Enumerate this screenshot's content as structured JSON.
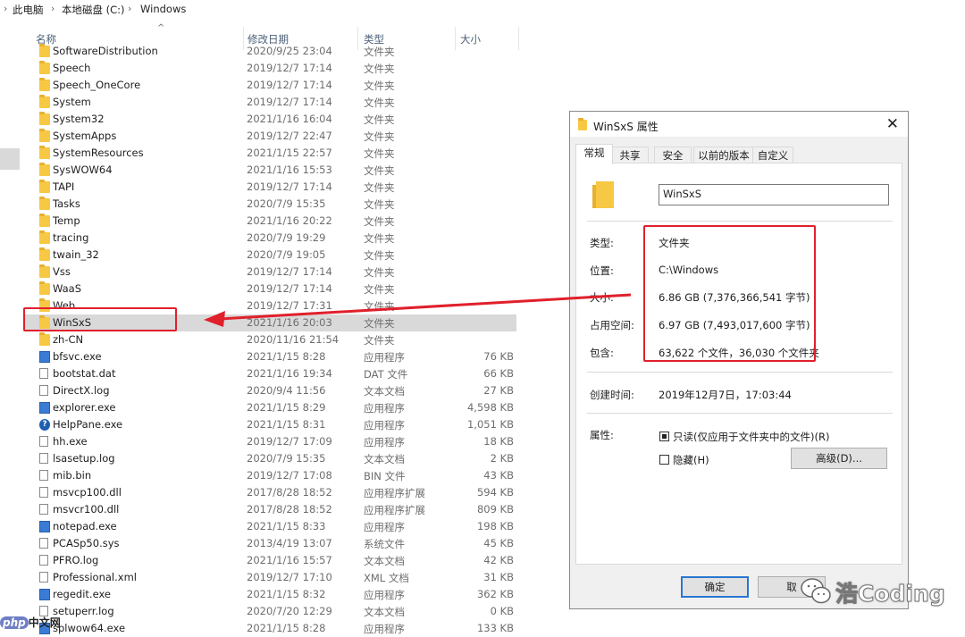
{
  "breadcrumb": [
    "此电脑",
    "本地磁盘 (C:)",
    "Windows"
  ],
  "columns": {
    "name": "名称",
    "date": "修改日期",
    "type": "类型",
    "size": "大小"
  },
  "files": [
    {
      "name": "SoftwareDistribution",
      "date": "2020/9/25 23:04",
      "type": "文件夹",
      "size": "",
      "icon": "folder-icon"
    },
    {
      "name": "Speech",
      "date": "2019/12/7 17:14",
      "type": "文件夹",
      "size": "",
      "icon": "folder-icon"
    },
    {
      "name": "Speech_OneCore",
      "date": "2019/12/7 17:14",
      "type": "文件夹",
      "size": "",
      "icon": "folder-icon"
    },
    {
      "name": "System",
      "date": "2019/12/7 17:14",
      "type": "文件夹",
      "size": "",
      "icon": "folder-icon"
    },
    {
      "name": "System32",
      "date": "2021/1/16 16:04",
      "type": "文件夹",
      "size": "",
      "icon": "folder-icon"
    },
    {
      "name": "SystemApps",
      "date": "2019/12/7 22:47",
      "type": "文件夹",
      "size": "",
      "icon": "folder-icon"
    },
    {
      "name": "SystemResources",
      "date": "2021/1/15 22:57",
      "type": "文件夹",
      "size": "",
      "icon": "folder-icon"
    },
    {
      "name": "SysWOW64",
      "date": "2021/1/16 15:53",
      "type": "文件夹",
      "size": "",
      "icon": "folder-icon"
    },
    {
      "name": "TAPI",
      "date": "2019/12/7 17:14",
      "type": "文件夹",
      "size": "",
      "icon": "folder-icon"
    },
    {
      "name": "Tasks",
      "date": "2020/7/9 15:35",
      "type": "文件夹",
      "size": "",
      "icon": "folder-icon"
    },
    {
      "name": "Temp",
      "date": "2021/1/16 20:22",
      "type": "文件夹",
      "size": "",
      "icon": "folder-icon"
    },
    {
      "name": "tracing",
      "date": "2020/7/9 19:29",
      "type": "文件夹",
      "size": "",
      "icon": "folder-icon"
    },
    {
      "name": "twain_32",
      "date": "2020/7/9 19:05",
      "type": "文件夹",
      "size": "",
      "icon": "folder-icon"
    },
    {
      "name": "Vss",
      "date": "2019/12/7 17:14",
      "type": "文件夹",
      "size": "",
      "icon": "folder-icon"
    },
    {
      "name": "WaaS",
      "date": "2019/12/7 17:14",
      "type": "文件夹",
      "size": "",
      "icon": "folder-icon"
    },
    {
      "name": "Web",
      "date": "2019/12/7 17:31",
      "type": "文件夹",
      "size": "",
      "icon": "folder-icon"
    },
    {
      "name": "WinSxS",
      "date": "2021/1/16 20:03",
      "type": "文件夹",
      "size": "",
      "icon": "folder-icon",
      "selected": true
    },
    {
      "name": "zh-CN",
      "date": "2020/11/16 21:54",
      "type": "文件夹",
      "size": "",
      "icon": "folder-icon"
    },
    {
      "name": "bfsvc.exe",
      "date": "2021/1/15 8:28",
      "type": "应用程序",
      "size": "76 KB",
      "icon": "exe-icon"
    },
    {
      "name": "bootstat.dat",
      "date": "2021/1/16 19:34",
      "type": "DAT 文件",
      "size": "66 KB",
      "icon": "file-icon"
    },
    {
      "name": "DirectX.log",
      "date": "2020/9/4 11:56",
      "type": "文本文档",
      "size": "27 KB",
      "icon": "file-icon"
    },
    {
      "name": "explorer.exe",
      "date": "2021/1/15 8:29",
      "type": "应用程序",
      "size": "4,598 KB",
      "icon": "explorer-icon"
    },
    {
      "name": "HelpPane.exe",
      "date": "2021/1/15 8:31",
      "type": "应用程序",
      "size": "1,051 KB",
      "icon": "help-icon"
    },
    {
      "name": "hh.exe",
      "date": "2019/12/7 17:09",
      "type": "应用程序",
      "size": "18 KB",
      "icon": "help-file-icon"
    },
    {
      "name": "lsasetup.log",
      "date": "2020/7/9 15:35",
      "type": "文本文档",
      "size": "2 KB",
      "icon": "file-icon"
    },
    {
      "name": "mib.bin",
      "date": "2019/12/7 17:08",
      "type": "BIN 文件",
      "size": "43 KB",
      "icon": "file-icon"
    },
    {
      "name": "msvcp100.dll",
      "date": "2017/8/28 18:52",
      "type": "应用程序扩展",
      "size": "594 KB",
      "icon": "dll-icon"
    },
    {
      "name": "msvcr100.dll",
      "date": "2017/8/28 18:52",
      "type": "应用程序扩展",
      "size": "809 KB",
      "icon": "dll-icon"
    },
    {
      "name": "notepad.exe",
      "date": "2021/1/15 8:33",
      "type": "应用程序",
      "size": "198 KB",
      "icon": "exe-icon"
    },
    {
      "name": "PCASp50.sys",
      "date": "2013/4/19 13:07",
      "type": "系统文件",
      "size": "45 KB",
      "icon": "file-icon"
    },
    {
      "name": "PFRO.log",
      "date": "2021/1/16 15:57",
      "type": "文本文档",
      "size": "42 KB",
      "icon": "file-icon"
    },
    {
      "name": "Professional.xml",
      "date": "2019/12/7 17:10",
      "type": "XML 文档",
      "size": "31 KB",
      "icon": "file-icon"
    },
    {
      "name": "regedit.exe",
      "date": "2021/1/15 8:32",
      "type": "应用程序",
      "size": "362 KB",
      "icon": "regedit-icon"
    },
    {
      "name": "setuperr.log",
      "date": "2020/7/20 12:29",
      "type": "文本文档",
      "size": "0 KB",
      "icon": "file-icon"
    },
    {
      "name": "splwow64.exe",
      "date": "2021/1/15 8:28",
      "type": "应用程序",
      "size": "133 KB",
      "icon": "exe-icon"
    }
  ],
  "dialog": {
    "title": "WinSxS 属性",
    "tabs": [
      "常规",
      "共享",
      "安全",
      "以前的版本",
      "自定义"
    ],
    "active_tab": 0,
    "name_value": "WinSxS",
    "props": [
      {
        "label": "类型:",
        "value": "文件夹"
      },
      {
        "label": "位置:",
        "value": "C:\\Windows"
      },
      {
        "label": "大小:",
        "value": "6.86 GB (7,376,366,541 字节)"
      },
      {
        "label": "占用空间:",
        "value": "6.97 GB (7,493,017,600 字节)"
      },
      {
        "label": "包含:",
        "value": "63,622 个文件，36,030 个文件夹"
      }
    ],
    "created_label": "创建时间:",
    "created_value": "2019年12月7日，17:03:44",
    "attrs_label": "属性:",
    "readonly_label": "只读(仅应用于文件夹中的文件)(R)",
    "readonly_checked": true,
    "hidden_label": "隐藏(H)",
    "hidden_checked": false,
    "advanced_button": "高级(D)...",
    "ok_button": "确定",
    "cancel_button": "取"
  },
  "watermark": "浩Coding",
  "corner_logo": {
    "badge": "php",
    "text": "中文网"
  },
  "colors": {
    "annotation_red": "#e0202b",
    "selection": "#d9d9d9",
    "folder": "#f7c843",
    "ok_border": "#2a76d2"
  }
}
